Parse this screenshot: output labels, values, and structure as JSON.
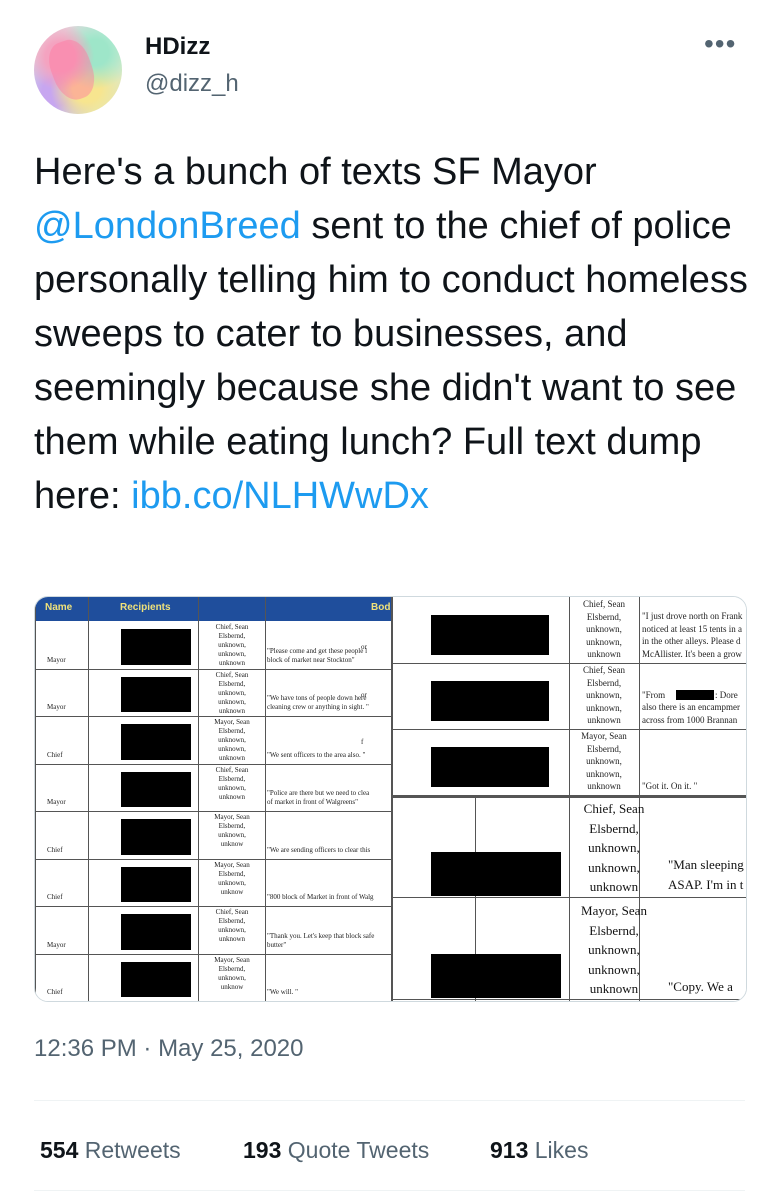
{
  "author": {
    "display_name": "HDizz",
    "handle": "@dizz_h"
  },
  "tweet": {
    "text_before": "Here's a bunch of texts SF Mayor ",
    "mention": "@LondonBreed",
    "text_middle": " sent to the chief of police personally telling him to conduct homeless sweeps to cater to businesses, and seemingly because she didn't want to see them while eating lunch? Full text dump here: ",
    "link": "ibb.co/NLHWwDx"
  },
  "media": {
    "left_headers": {
      "name": "Name",
      "recipients": "Recipients",
      "body": "Bod"
    },
    "left_rows": [
      {
        "name": "Mayor",
        "recipients": [
          "Chief, Sean",
          "Elsbernd,",
          "unknown,",
          "unknown,",
          "unknown"
        ],
        "body": [
          "\"Please come and get these people l",
          "block of market near Stockton\""
        ],
        "spill": "or"
      },
      {
        "name": "Mayor",
        "recipients": [
          "Chief, Sean",
          "Elsbernd,",
          "unknown,",
          "unknown,",
          "unknown"
        ],
        "body": [
          "\"We have tons of people down here",
          "cleaning crew or anything in sight. \""
        ],
        "spill": "or"
      },
      {
        "name": "Chief",
        "recipients": [
          "Mayor, Sean",
          "Elsbernd,",
          "unknown,",
          "unknown,",
          "unknown"
        ],
        "body": [
          "\"We sent officers to the area also. \""
        ],
        "spill": "f"
      },
      {
        "name": "Mayor",
        "recipients": [
          "Chief, Sean",
          "Elsbernd,",
          "unknown,",
          "unknown"
        ],
        "body": [
          "\"Police are there but we need to clea",
          "of market in front of Walgreens\""
        ],
        "spill": ""
      },
      {
        "name": "Chief",
        "recipients": [
          "Mayor, Sean",
          "Elsbernd,",
          "unknown,",
          "unknow"
        ],
        "body": [
          "\"We are sending officers to clear this"
        ],
        "spill": ""
      },
      {
        "name": "Chief",
        "recipients": [
          "Mayor, Sean",
          "Elsbernd,",
          "unknown,",
          "unknow"
        ],
        "body": [
          "\"800 block of Market in front of Walg"
        ],
        "spill": ""
      },
      {
        "name": "Mayor",
        "recipients": [
          "Chief, Sean",
          "Elsbernd,",
          "unknown,",
          "unknown"
        ],
        "body": [
          "\"Thank you. Let's keep that block safe",
          "butter\""
        ],
        "spill": ""
      },
      {
        "name": "Chief",
        "recipients": [
          "Mayor, Sean",
          "Elsbernd,",
          "unknown,",
          "unknow"
        ],
        "body": [
          "\"We will. \""
        ],
        "spill": ""
      }
    ],
    "right_rows_small": [
      {
        "recipients": [
          "Chief, Sean",
          "Elsbernd,",
          "unknown,",
          "unknown,",
          "unknown"
        ],
        "body": [
          "\"I just drove north on Frank",
          "noticed at least 15 tents in a",
          "in the other alleys. Please d",
          "McAllister. It's been a grow"
        ]
      },
      {
        "recipients": [
          "Chief, Sean",
          "Elsbernd,",
          "unknown,",
          "unknown,",
          "unknown"
        ],
        "body": [
          "\"From",
          "also there is an encampmer",
          "across from 1000 Brannan"
        ],
        "body_tail": ": Dore"
      },
      {
        "recipients": [
          "Mayor, Sean",
          "Elsbernd,",
          "unknown,",
          "unknown,",
          "unknown"
        ],
        "body": [
          "\"Got it. On it. \""
        ]
      }
    ],
    "right_rows_large": [
      {
        "recipients": [
          "Chief, Sean",
          "Elsbernd,",
          "unknown,",
          "unknown,",
          "unknown"
        ],
        "body": [
          "\"Man sleeping",
          "ASAP. I'm in t"
        ]
      },
      {
        "recipients": [
          "Mayor, Sean",
          "Elsbernd,",
          "unknown,",
          "unknown,",
          "unknown"
        ],
        "body": [
          "\"Copy. We a"
        ]
      }
    ]
  },
  "meta": {
    "time": "12:36 PM",
    "separator": " · ",
    "date": "May 25, 2020"
  },
  "stats": {
    "retweets_count": "554",
    "retweets_label": "Retweets",
    "quotes_count": "193",
    "quotes_label": "Quote Tweets",
    "likes_count": "913",
    "likes_label": "Likes"
  },
  "colors": {
    "link": "#1d9bf0",
    "secondary_text": "#536471",
    "sheet_header": "#1f4e9c"
  }
}
